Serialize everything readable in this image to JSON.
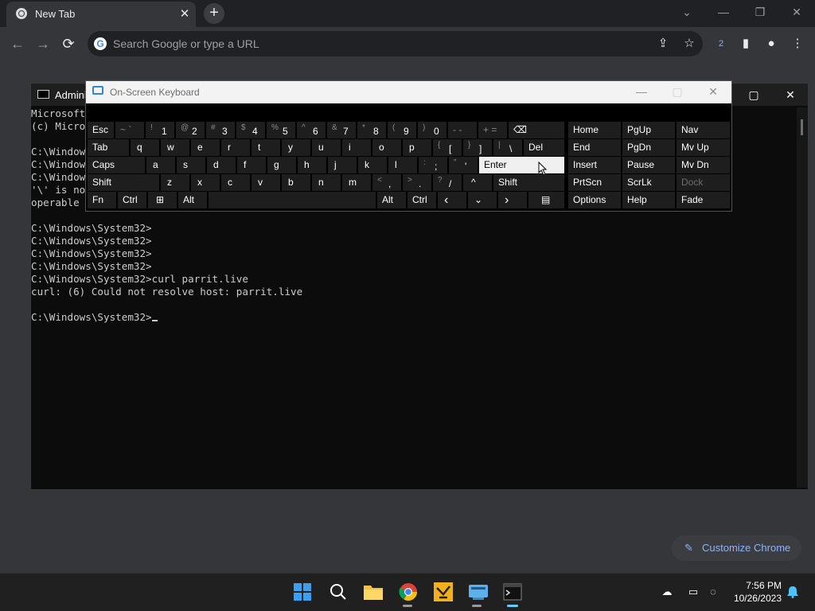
{
  "browser": {
    "tab_title": "New Tab",
    "tab_close": "✕",
    "new_tab": "+",
    "omnibox_placeholder": "Search Google or type a URL",
    "g_logo": "G",
    "window_controls": [
      "⌄",
      "—",
      "❐",
      "✕"
    ],
    "nav": {
      "back": "←",
      "forward": "→",
      "reload": "⟳"
    },
    "toolbar_icons": {
      "share": "⇪",
      "star": "☆",
      "download_badge": "2",
      "sidepanel": "▮",
      "profile": "●",
      "menu": "⋮"
    },
    "customize_label": "Customize Chrome",
    "customize_icon": "✎"
  },
  "cmd": {
    "title": "Admini",
    "controls": [
      "—",
      "▢",
      "✕"
    ],
    "lines": [
      "Microsoft",
      "(c) Micro",
      "",
      "C:\\Window",
      "C:\\Window",
      "C:\\Window",
      "'\\' is no",
      "operable",
      "",
      "C:\\Windows\\System32>",
      "C:\\Windows\\System32>",
      "C:\\Windows\\System32>",
      "C:\\Windows\\System32>",
      "C:\\Windows\\System32>curl parrit.live",
      "curl: (6) Could not resolve host: parrit.live",
      ""
    ],
    "prompt": "C:\\Windows\\System32>"
  },
  "osk": {
    "title": "On-Screen Keyboard",
    "controls": [
      "—",
      "▢",
      "✕"
    ],
    "keys": {
      "esc": "Esc",
      "tilde": "~ `",
      "1": "1",
      "1s": "!",
      "2": "2",
      "2s": "@",
      "3": "3",
      "3s": "#",
      "4": "4",
      "4s": "$",
      "5": "5",
      "5s": "%",
      "6": "6",
      "6s": "^",
      "7": "7",
      "7s": "&",
      "8": "8",
      "8s": "*",
      "9": "9",
      "9s": "(",
      "0": "0",
      "0s": ")",
      "minus": "- -",
      "plus": "+ =",
      "backspace": "⌫",
      "tab": "Tab",
      "q": "q",
      "w": "w",
      "e": "e",
      "r": "r",
      "t": "t",
      "y": "y",
      "u": "u",
      "i": "i",
      "o": "o",
      "p": "p",
      "lbr": "[",
      "lbrs": "{",
      "rbr": "]",
      "rbrs": "}",
      "bslash": "\\",
      "bslashs": "|",
      "del": "Del",
      "caps": "Caps",
      "a": "a",
      "s": "s",
      "d": "d",
      "f": "f",
      "g": "g",
      "h": "h",
      "j": "j",
      "k": "k",
      "l": "l",
      "semi": ";",
      "semis": ":",
      "quote": "'",
      "quotes": "\"",
      "enter": "Enter",
      "shift": "Shift",
      "z": "z",
      "x": "x",
      "c": "c",
      "v": "v",
      "b": "b",
      "n": "n",
      "m": "m",
      "comma": ",",
      "commas": "<",
      "period": ".",
      "periods": ">",
      "slash": "/",
      "slashs": "?",
      "up": "^",
      "shift_r": "Shift",
      "fn": "Fn",
      "ctrl": "Ctrl",
      "win": "⊞",
      "alt": "Alt",
      "alt_r": "Alt",
      "ctrl_r": "Ctrl",
      "left": "‹",
      "down": "⌄",
      "right": "›",
      "menu": "▤",
      "home": "Home",
      "pgup": "PgUp",
      "nav": "Nav",
      "end": "End",
      "pgdn": "PgDn",
      "mvup": "Mv Up",
      "insert": "Insert",
      "pause": "Pause",
      "mvdn": "Mv Dn",
      "prtscn": "PrtScn",
      "scrlk": "ScrLk",
      "dock": "Dock",
      "options": "Options",
      "help": "Help",
      "fade": "Fade"
    }
  },
  "taskbar": {
    "apps": [
      "⊞",
      "⌕",
      "▬",
      "◉",
      "✪",
      "▭",
      "▪"
    ],
    "tray": {
      "onedrive": "☁",
      "network": "▭",
      "volume": "◌",
      "bell": "🔔"
    },
    "time": "7:56 PM",
    "date": "10/26/2023"
  }
}
